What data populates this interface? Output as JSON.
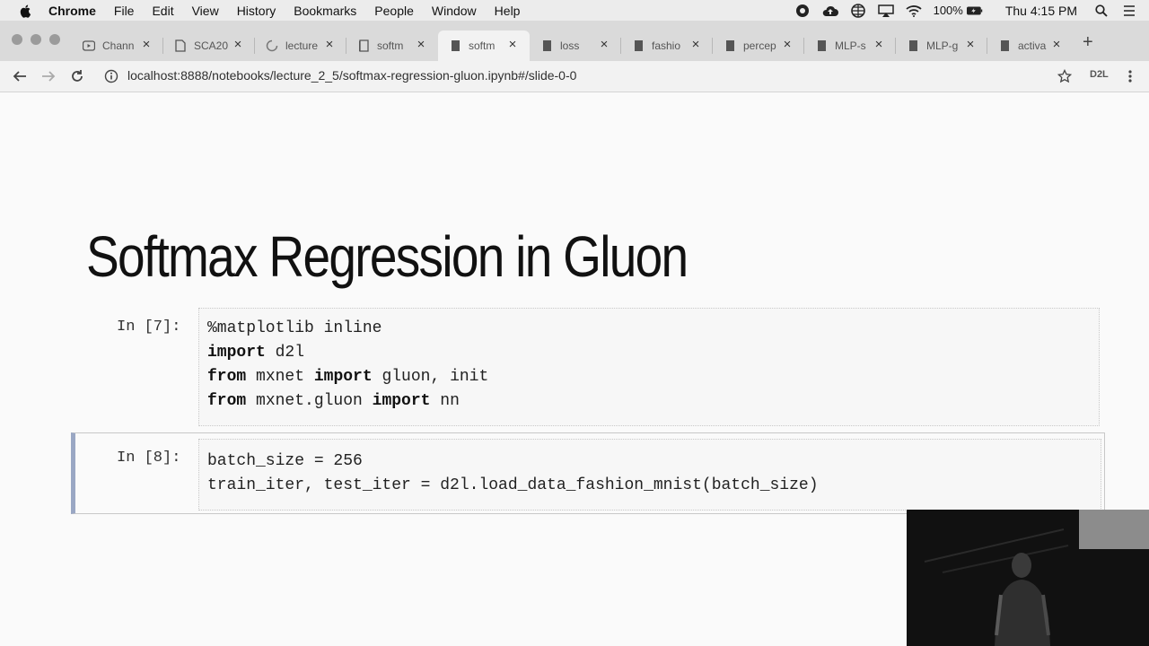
{
  "menubar": {
    "app": "Chrome",
    "items": [
      "File",
      "Edit",
      "View",
      "History",
      "Bookmarks",
      "People",
      "Window",
      "Help"
    ],
    "battery": "100%",
    "clock": "Thu 4:15 PM"
  },
  "tabs": [
    {
      "label": "Chann",
      "icon": "youtube-icon"
    },
    {
      "label": "SCA20",
      "icon": "document-icon"
    },
    {
      "label": "lecture",
      "icon": "loading-icon"
    },
    {
      "label": "softm",
      "icon": "book-icon"
    },
    {
      "label": "softm",
      "icon": "book-icon",
      "active": true
    },
    {
      "label": "loss",
      "icon": "book-icon"
    },
    {
      "label": "fashio",
      "icon": "book-icon"
    },
    {
      "label": "percep",
      "icon": "book-icon"
    },
    {
      "label": "MLP-s",
      "icon": "book-icon"
    },
    {
      "label": "MLP-g",
      "icon": "book-icon"
    },
    {
      "label": "activa",
      "icon": "book-icon"
    }
  ],
  "toolbar": {
    "url": "localhost:8888/notebooks/lecture_2_5/softmax-regression-gluon.ipynb#/slide-0-0",
    "extension": "D2L"
  },
  "notebook": {
    "title": "Softmax Regression in Gluon",
    "cells": [
      {
        "prompt": "In [7]:",
        "lines": [
          [
            {
              "t": "%matplotlib inline",
              "kw": false
            }
          ],
          [
            {
              "t": "import",
              "kw": true
            },
            {
              "t": " d2l",
              "kw": false
            }
          ],
          [
            {
              "t": "from",
              "kw": true
            },
            {
              "t": " mxnet ",
              "kw": false
            },
            {
              "t": "import",
              "kw": true
            },
            {
              "t": " gluon, init",
              "kw": false
            }
          ],
          [
            {
              "t": "from",
              "kw": true
            },
            {
              "t": " mxnet.gluon ",
              "kw": false
            },
            {
              "t": "import",
              "kw": true
            },
            {
              "t": " nn",
              "kw": false
            }
          ]
        ]
      },
      {
        "prompt": "In [8]:",
        "lines": [
          [
            {
              "t": "batch_size = 256",
              "kw": false
            }
          ],
          [
            {
              "t": "train_iter, test_iter = d2l.load_data_fashion_mnist(batch_size)",
              "kw": false
            }
          ]
        ]
      }
    ]
  }
}
